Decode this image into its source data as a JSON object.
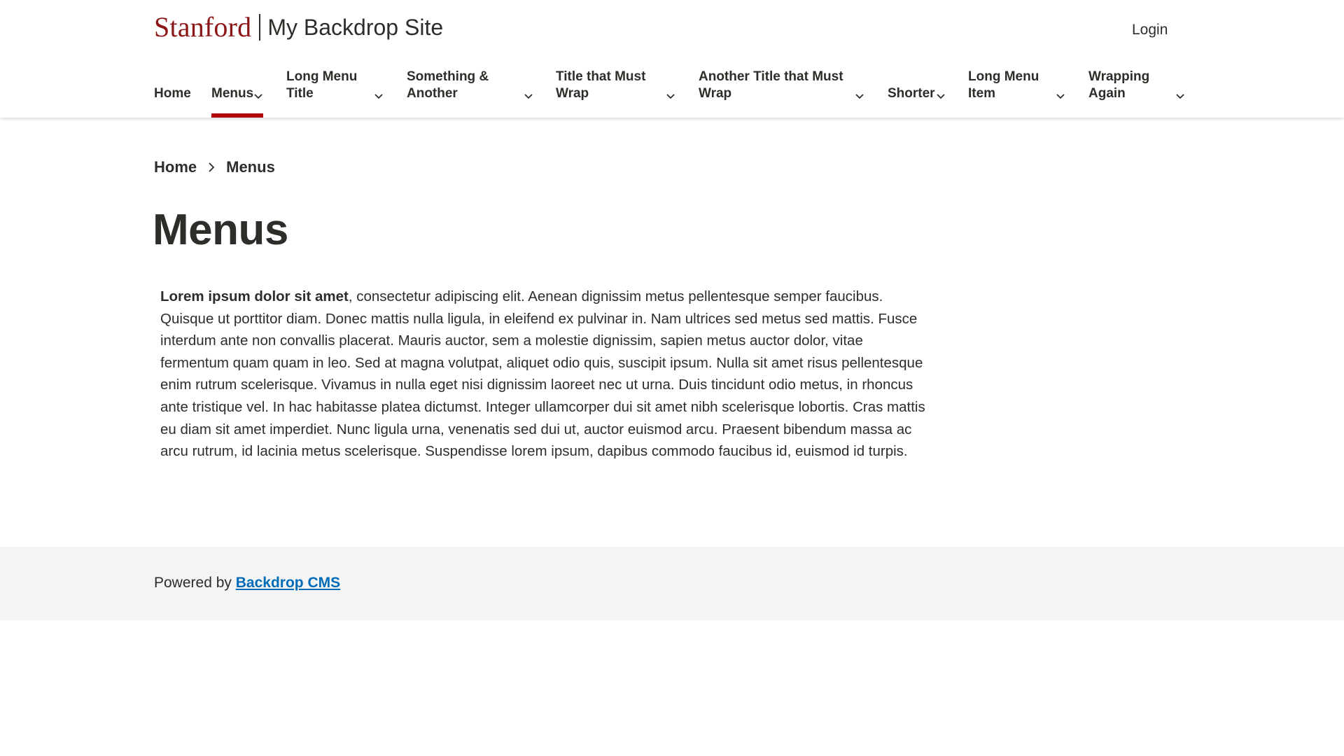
{
  "header": {
    "logo_text": "Stanford",
    "site_name": "My Backdrop Site",
    "login_label": "Login"
  },
  "nav": {
    "items": [
      {
        "label": "Home",
        "has_dropdown": false,
        "active": false
      },
      {
        "label": "Menus",
        "has_dropdown": true,
        "active": true
      },
      {
        "label": "Long Menu Title",
        "has_dropdown": true,
        "active": false
      },
      {
        "label": "Something & Another",
        "has_dropdown": true,
        "active": false
      },
      {
        "label": "Title that Must Wrap",
        "has_dropdown": true,
        "active": false
      },
      {
        "label": "Another Title that Must Wrap",
        "has_dropdown": true,
        "active": false
      },
      {
        "label": "Shorter",
        "has_dropdown": true,
        "active": false
      },
      {
        "label": "Long Menu Item",
        "has_dropdown": true,
        "active": false
      },
      {
        "label": "Wrapping Again",
        "has_dropdown": true,
        "active": false
      }
    ]
  },
  "breadcrumb": {
    "items": [
      "Home",
      "Menus"
    ]
  },
  "main": {
    "title": "Menus",
    "body_lead": "Lorem ipsum dolor sit amet",
    "body_rest": ", consectetur adipiscing elit. Aenean dignissim metus pellentesque semper faucibus. Quisque ut porttitor diam. Donec mattis nulla ligula, in eleifend ex pulvinar in. Nam ultrices sed metus sed mattis. Fusce interdum ante non convallis placerat. Mauris auctor, sem a molestie dignissim, sapien metus auctor dolor, vitae fermentum quam quam in leo. Sed at magna volutpat, aliquet odio quis, suscipit ipsum. Nulla sit amet risus pellentesque enim rutrum scelerisque. Vivamus in nulla eget nisi dignissim laoreet nec ut urna. Duis tincidunt odio metus, in rhoncus ante tristique vel. In hac habitasse platea dictumst. Integer ullamcorper dui sit amet nibh scelerisque lobortis. Cras mattis eu diam sit amet imperdiet. Nunc ligula urna, venenatis sed dui ut, auctor euismod arcu. Praesent bibendum massa ac arcu rutrum, id lacinia metus scelerisque. Suspendisse lorem ipsum, dapibus commodo faucibus id, euismod id turpis."
  },
  "footer": {
    "prefix": "Powered by",
    "link_label": "Backdrop CMS"
  },
  "colors": {
    "brand_red": "#8c1515",
    "active_bar": "#b1040e",
    "link_blue": "#006cb8",
    "text": "#2e2d29",
    "footer_bg": "#f4f4f4"
  },
  "icons": {
    "nav_dropdown": "chevron-down-icon",
    "breadcrumb_separator": "chevron-right-icon"
  }
}
